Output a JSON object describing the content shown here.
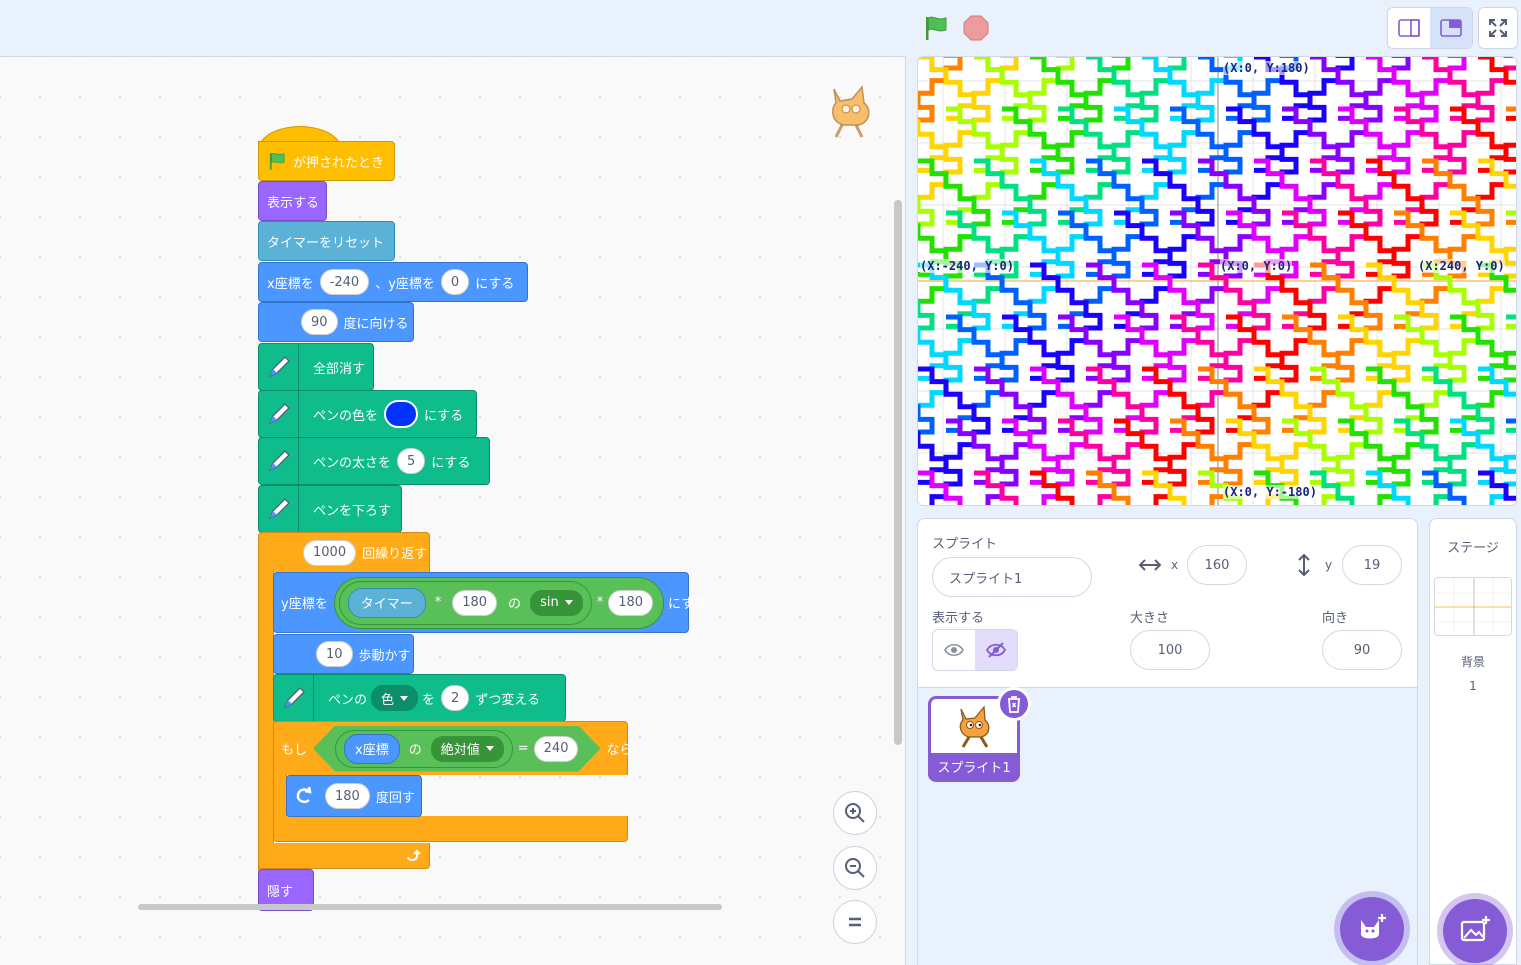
{
  "toolbar": {
    "green_flag_icon": "green-flag-icon",
    "stop_icon": "stop-icon",
    "colors": {
      "flag": "#4cbf56",
      "stop": "#ec9c9c"
    }
  },
  "blocks": {
    "hat_label": "が押されたとき",
    "show_label": "表示する",
    "reset_timer_label": "タイマーをリセット",
    "goto": {
      "pre": "x座標を",
      "x": "-240",
      "mid": "、y座標を",
      "y": "0",
      "post": "にする"
    },
    "point": {
      "deg": "90",
      "label": "度に向ける"
    },
    "erase_label": "全部消す",
    "pen_color": {
      "pre": "ペンの色を",
      "post": "にする",
      "swatch": "#0033ff"
    },
    "pen_size": {
      "pre": "ペンの太さを",
      "value": "5",
      "post": "にする"
    },
    "pen_down_label": "ペンを下ろす",
    "repeat": {
      "count": "1000",
      "label": "回繰り返す"
    },
    "set_y": {
      "pre": "y座標を",
      "timer": "タイマー",
      "times1": "*",
      "num1": "180",
      "of": "の",
      "func": "sin",
      "times2": "*",
      "num2": "180",
      "post": "にする"
    },
    "move": {
      "steps": "10",
      "label": "歩動かす"
    },
    "change_pen": {
      "pre": "ペンの",
      "param": "色",
      "mid": "を",
      "value": "2",
      "post": "ずつ変える"
    },
    "if": {
      "pre": "もし",
      "xpos": "x座標",
      "of": "の",
      "func": "絶対値",
      "eq": "=",
      "value": "240",
      "post": "なら"
    },
    "turn": {
      "deg": "180",
      "label": "度回す"
    },
    "hide_label": "隠す"
  },
  "sprite_info": {
    "sprite_label": "スプライト",
    "sprite_name": "スプライト1",
    "x_label": "x",
    "x_value": "160",
    "y_label": "y",
    "y_value": "19",
    "show_label": "表示する",
    "size_label": "大きさ",
    "size_value": "100",
    "direction_label": "向き",
    "direction_value": "90"
  },
  "sprite_list": {
    "tile_name": "スプライト1"
  },
  "stage_panel": {
    "title": "ステージ",
    "backdrop_label": "背景",
    "backdrop_count": "1"
  },
  "stage_overlay": {
    "top_label": "(X:0, Y:180)",
    "bottom_label": "(X:0, Y:-180)",
    "left_label": "(X:-240, Y:0)",
    "center_label": "(X:0, Y:0)",
    "right_label": "(X:240, Y:0)"
  }
}
